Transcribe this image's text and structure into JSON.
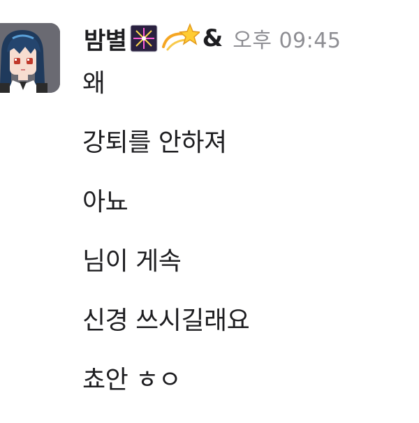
{
  "message": {
    "author": {
      "name": "밤별",
      "badges": [
        {
          "icon": "fireworks-emoji-icon"
        },
        {
          "icon": "dizzy-star-emoji-icon"
        }
      ],
      "suffix": "&",
      "avatar": "pixel-art-character-avatar"
    },
    "timestamp": "오후 09:45",
    "lines": [
      "왜",
      "강퇴를 안하져",
      "아뇨",
      "님이 게속",
      "신경 쓰시길래요",
      "쵸안 ㅎㅇ"
    ]
  },
  "colors": {
    "text": "#1d1d20",
    "timestamp": "#8e8e93",
    "avatar_bg": "#6a6a72",
    "background": "#ffffff"
  }
}
